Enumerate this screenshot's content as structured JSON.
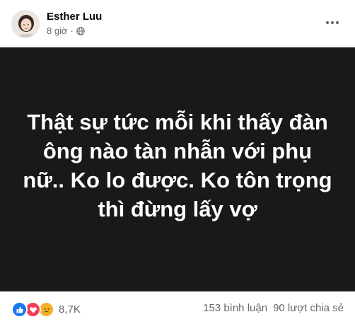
{
  "post": {
    "author": "Esther Luu",
    "time": "8 giờ",
    "separator": "·",
    "body_text": "Thật sự tức mỗi khi thấy đàn ông nào tàn nhẫn với phụ nữ.. Ko lo được. Ko tôn trọng thì đừng lấy vợ"
  },
  "icons": {
    "audience": "globe-icon",
    "menu": "more-options-icon",
    "reactions": [
      "like-icon",
      "love-icon",
      "sad-icon"
    ]
  },
  "footer": {
    "reaction_count": "8,7K",
    "comments": "153 bình luận",
    "shares": "90 lượt chia sẻ"
  },
  "colors": {
    "banner_bg": "#18191b",
    "like": "#1877f2",
    "love": "#f33e58",
    "sad": "#f7b125",
    "secondary_text": "#65676b"
  }
}
